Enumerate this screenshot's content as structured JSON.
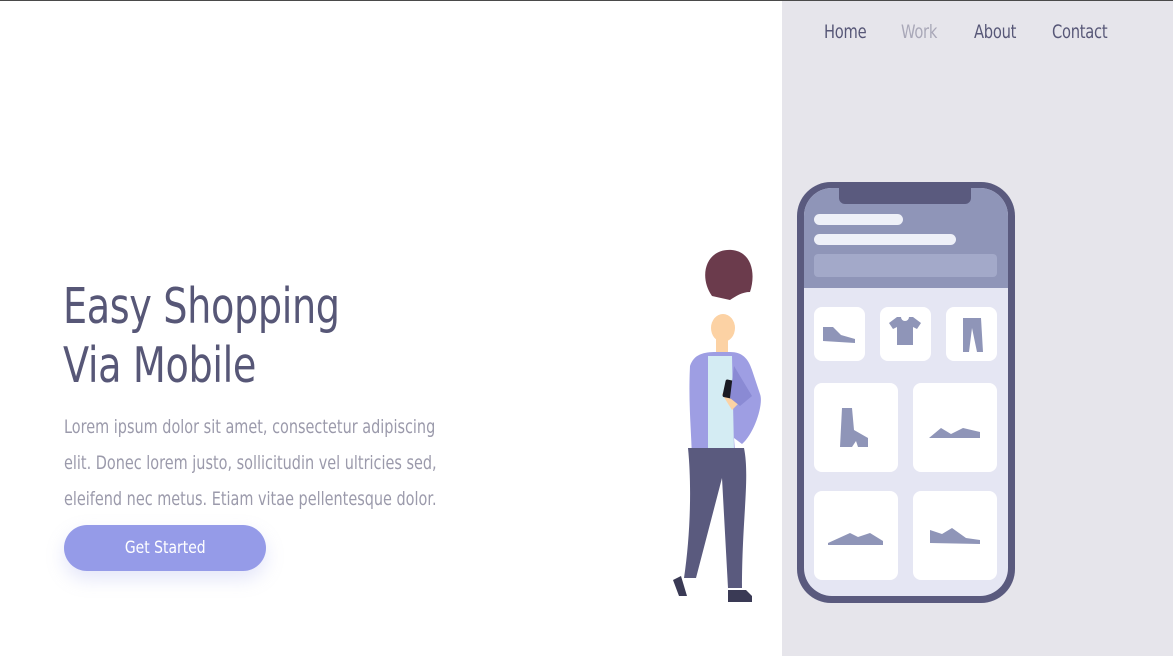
{
  "nav": {
    "items": [
      {
        "label": "Home",
        "active": false
      },
      {
        "label": "Work",
        "active": true
      },
      {
        "label": "About",
        "active": false
      },
      {
        "label": "Contact",
        "active": false
      }
    ]
  },
  "hero": {
    "title_line1": "Easy Shopping",
    "title_line2": "Via Mobile",
    "description": "Lorem ipsum dolor sit amet, consectetur adipiscing elit. Donec lorem justo, sollicitudin vel ultricies sed, eleifend nec metus. Etiam vitae pellentesque dolor.",
    "cta_label": "Get Started"
  },
  "colors": {
    "primary_text": "#575777",
    "muted_text": "#9b9aab",
    "accent": "#959be8",
    "panel_bg": "#e6e5eb",
    "phone_frame": "#5a5a7e",
    "phone_header": "#8f95b8"
  },
  "illustration": {
    "icons": [
      "sneaker-icon",
      "tshirt-icon",
      "pants-icon",
      "boot-icon",
      "shoe-icon",
      "sneaker-icon",
      "sneaker-icon"
    ]
  }
}
